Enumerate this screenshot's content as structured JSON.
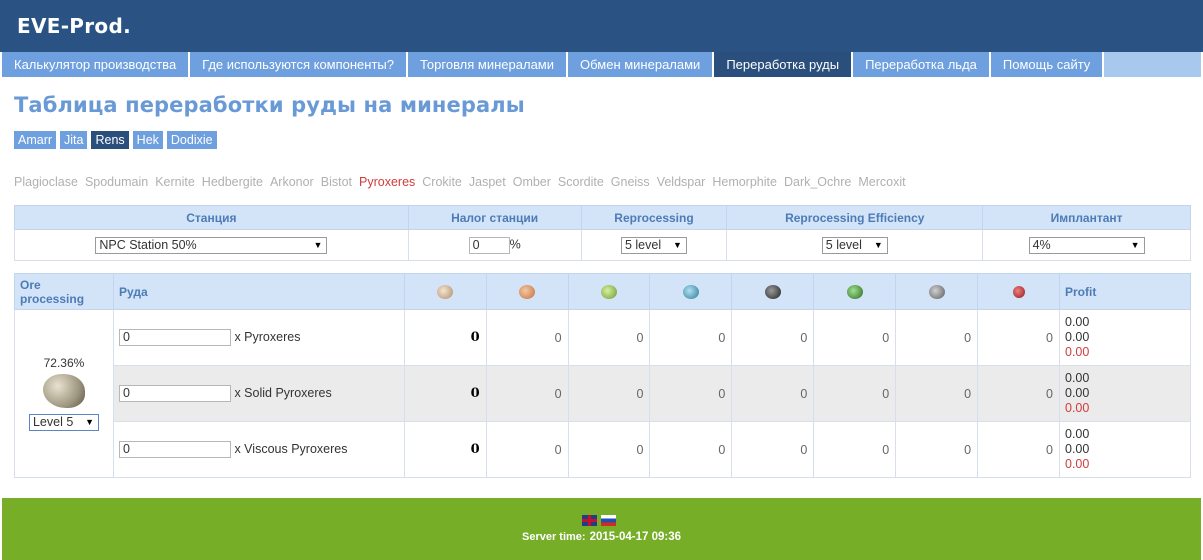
{
  "header": {
    "logo": "EVE-Prod."
  },
  "nav": [
    {
      "label": "Калькулятор производства",
      "active": false
    },
    {
      "label": "Где используются компоненты?",
      "active": false
    },
    {
      "label": "Торговля минералами",
      "active": false
    },
    {
      "label": "Обмен минералами",
      "active": false
    },
    {
      "label": "Переработка руды",
      "active": true
    },
    {
      "label": "Переработка льда",
      "active": false
    },
    {
      "label": "Помощь сайту",
      "active": false
    }
  ],
  "page_title": "Таблица переработки руды на минералы",
  "hubs": [
    {
      "label": "Amarr",
      "active": false
    },
    {
      "label": "Jita",
      "active": false
    },
    {
      "label": "Rens",
      "active": true
    },
    {
      "label": "Hek",
      "active": false
    },
    {
      "label": "Dodixie",
      "active": false
    }
  ],
  "ore_types": [
    {
      "label": "Plagioclase",
      "active": false
    },
    {
      "label": "Spodumain",
      "active": false
    },
    {
      "label": "Kernite",
      "active": false
    },
    {
      "label": "Hedbergite",
      "active": false
    },
    {
      "label": "Arkonor",
      "active": false
    },
    {
      "label": "Bistot",
      "active": false
    },
    {
      "label": "Pyroxeres",
      "active": true
    },
    {
      "label": "Crokite",
      "active": false
    },
    {
      "label": "Jaspet",
      "active": false
    },
    {
      "label": "Omber",
      "active": false
    },
    {
      "label": "Scordite",
      "active": false
    },
    {
      "label": "Gneiss",
      "active": false
    },
    {
      "label": "Veldspar",
      "active": false
    },
    {
      "label": "Hemorphite",
      "active": false
    },
    {
      "label": "Dark_Ochre",
      "active": false
    },
    {
      "label": "Mercoxit",
      "active": false
    }
  ],
  "settings": {
    "headers": {
      "station": "Станция",
      "tax": "Налог станции",
      "reprocessing": "Reprocessing",
      "efficiency": "Reprocessing Efficiency",
      "implant": "Имплантант"
    },
    "station_value": "NPC Station 50%",
    "tax_value": "0",
    "tax_unit": "%",
    "reprocessing_value": "5 level",
    "efficiency_value": "5 level",
    "implant_value": "4%"
  },
  "main_table": {
    "headers": {
      "ore_processing": "Ore processing",
      "ore": "Руда",
      "profit": "Profit"
    },
    "mineral_icons": [
      {
        "name": "tritanium-icon",
        "color": "#d9c4a8"
      },
      {
        "name": "pyerite-icon",
        "color": "#e0a070"
      },
      {
        "name": "mexallon-icon",
        "color": "#9ec45a"
      },
      {
        "name": "isogen-icon",
        "color": "#5aa8c8"
      },
      {
        "name": "nocxium-icon",
        "color": "#404040"
      },
      {
        "name": "zydrine-icon",
        "color": "#4aa040"
      },
      {
        "name": "megacyte-icon",
        "color": "#8a8a8a"
      },
      {
        "name": "morphite-icon",
        "color": "#c03030"
      }
    ],
    "efficiency_pct": "72.36%",
    "level_select": "Level 5",
    "rows": [
      {
        "qty": "0",
        "name": "x Pyroxeres",
        "values": [
          "0",
          "0",
          "0",
          "0",
          "0",
          "0",
          "0",
          "0"
        ],
        "profit": [
          "0.00",
          "0.00",
          "0.00"
        ]
      },
      {
        "qty": "0",
        "name": "x Solid Pyroxeres",
        "values": [
          "0",
          "0",
          "0",
          "0",
          "0",
          "0",
          "0",
          "0"
        ],
        "profit": [
          "0.00",
          "0.00",
          "0.00"
        ]
      },
      {
        "qty": "0",
        "name": "x Viscous Pyroxeres",
        "values": [
          "0",
          "0",
          "0",
          "0",
          "0",
          "0",
          "0",
          "0"
        ],
        "profit": [
          "0.00",
          "0.00",
          "0.00"
        ]
      }
    ]
  },
  "footer": {
    "server_time_label": "Server time:",
    "server_time_value": "2015-04-17 09:36"
  }
}
